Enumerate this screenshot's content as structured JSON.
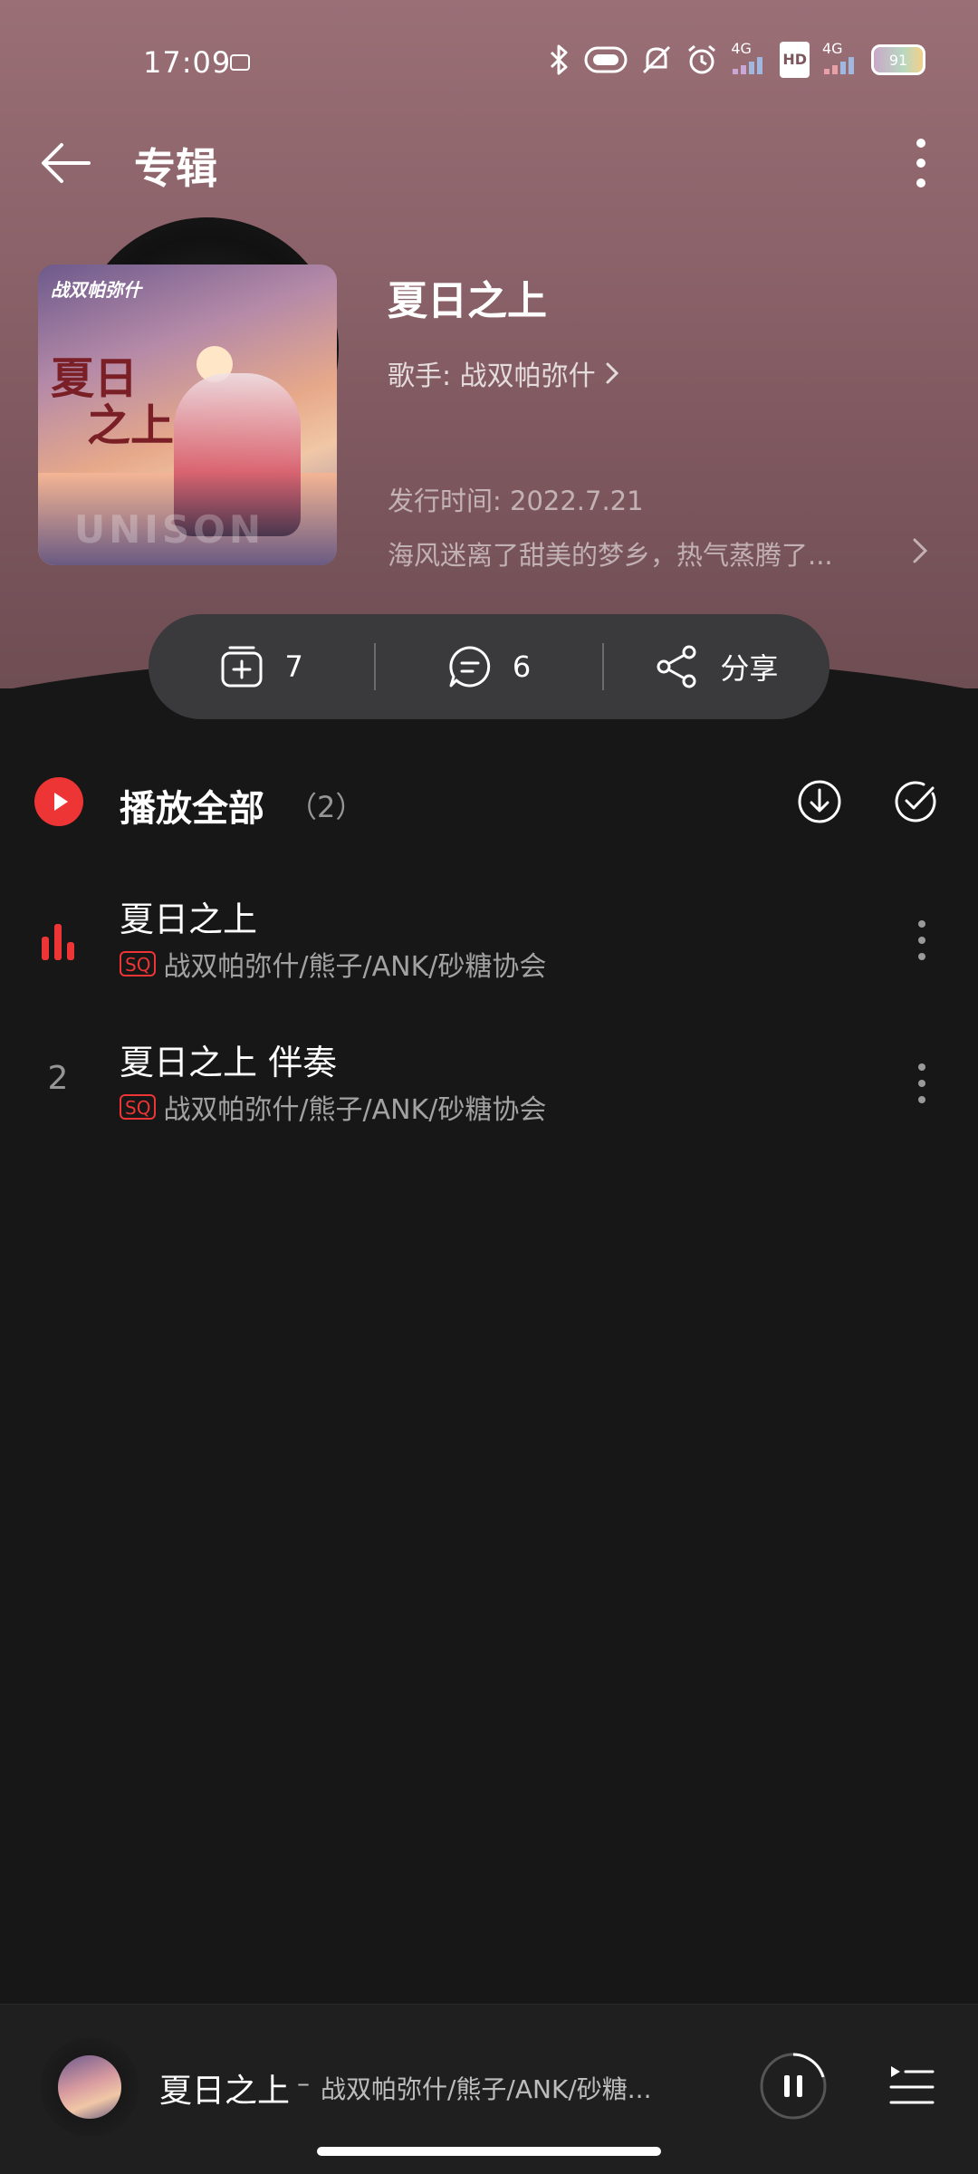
{
  "status_bar": {
    "time": "17:09",
    "network_1": "4G",
    "hd": "HD",
    "network_2": "4G",
    "battery": "91"
  },
  "header": {
    "title": "专辑"
  },
  "album": {
    "cover_brand": "战双帕弥什",
    "cover_title_line1": "夏日",
    "cover_title_line2": "之上",
    "cover_watermark": "UNISON",
    "title": "夏日之上",
    "artist_label": "歌手: 战双帕弥什",
    "release_date": "发行时间: 2022.7.21",
    "description": "海风迷离了甜美的梦乡，热气蒸腾了..."
  },
  "actions": {
    "collect_count": "7",
    "comment_count": "6",
    "share_label": "分享"
  },
  "play_all": {
    "label": "播放全部",
    "count": "（2）"
  },
  "tracks": [
    {
      "index": "1",
      "title": "夏日之上",
      "badge": "SQ",
      "artists": "战双帕弥什/熊子/ANK/砂糖协会",
      "playing": true
    },
    {
      "index": "2",
      "title": "夏日之上 伴奏",
      "badge": "SQ",
      "artists": "战双帕弥什/熊子/ANK/砂糖协会",
      "playing": false
    }
  ],
  "mini_player": {
    "title": "夏日之上",
    "separator": "–",
    "artist": "战双帕弥什/熊子/ANK/砂糖..."
  },
  "colors": {
    "accent": "#ee3535",
    "background": "#171717",
    "hero_top": "#9a6f76",
    "action_bar": "#3a3a3c"
  }
}
